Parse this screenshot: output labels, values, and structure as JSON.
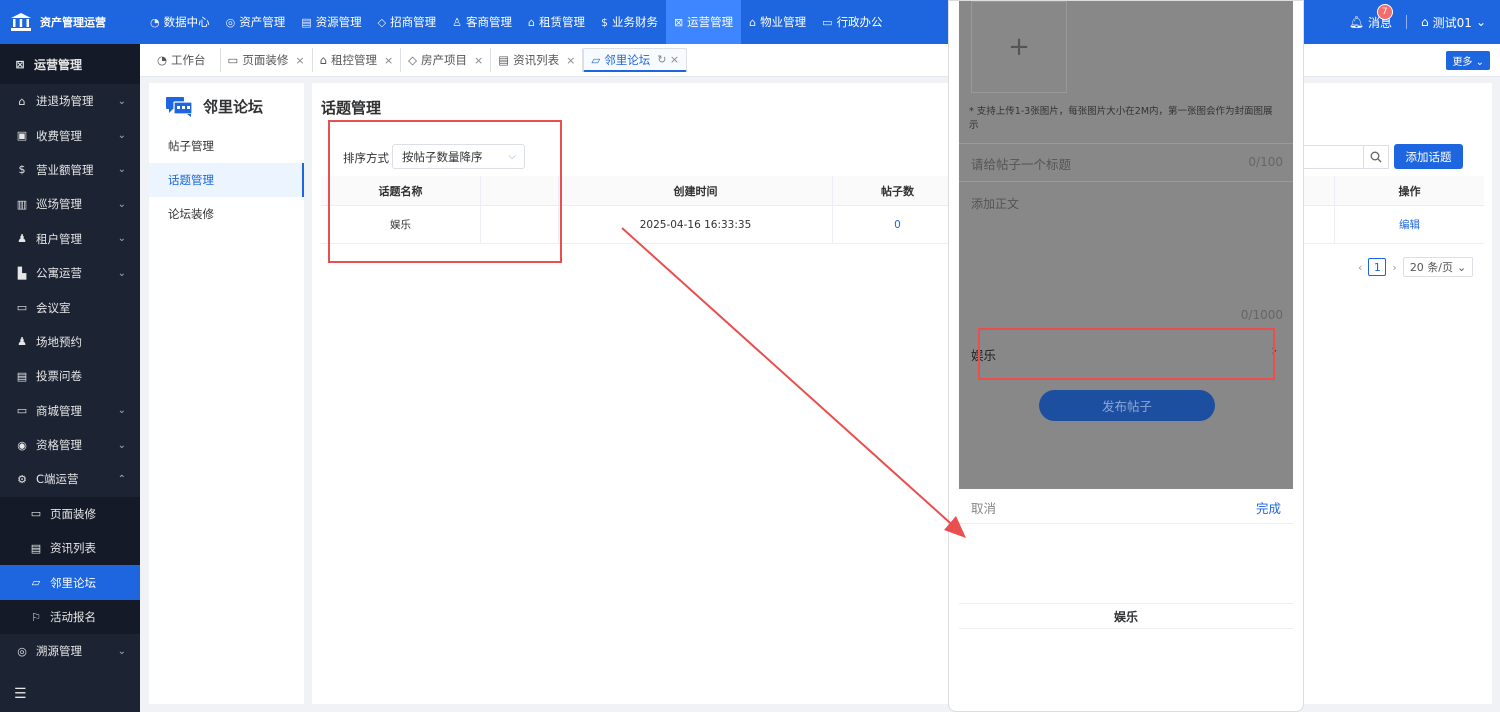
{
  "brand": {
    "name": "资产管理运营"
  },
  "topnav": [
    {
      "icon": "◔",
      "label": "数据中心"
    },
    {
      "icon": "◎",
      "label": "资产管理"
    },
    {
      "icon": "▤",
      "label": "资源管理"
    },
    {
      "icon": "◇",
      "label": "招商管理"
    },
    {
      "icon": "♙",
      "label": "客商管理"
    },
    {
      "icon": "⌂",
      "label": "租赁管理"
    },
    {
      "icon": "$",
      "label": "业务财务"
    },
    {
      "icon": "⊠",
      "label": "运营管理"
    },
    {
      "icon": "⌂",
      "label": "物业管理"
    },
    {
      "icon": "▭",
      "label": "行政办公"
    }
  ],
  "top_right": {
    "message_label": "消息",
    "message_count": "7",
    "user_label": "测试01"
  },
  "sidebar": {
    "header": "运营管理",
    "items": [
      {
        "icon": "⌂",
        "label": "进退场管理",
        "chev": "⌄"
      },
      {
        "icon": "▣",
        "label": "收费管理",
        "chev": "⌄"
      },
      {
        "icon": "$",
        "label": "营业额管理",
        "chev": "⌄"
      },
      {
        "icon": "▥",
        "label": "巡场管理",
        "chev": "⌄"
      },
      {
        "icon": "♟",
        "label": "租户管理",
        "chev": "⌄"
      },
      {
        "icon": "▙",
        "label": "公寓运营",
        "chev": "⌄"
      },
      {
        "icon": "▭",
        "label": "会议室",
        "chev": ""
      },
      {
        "icon": "♟",
        "label": "场地预约",
        "chev": ""
      },
      {
        "icon": "▤",
        "label": "投票问卷",
        "chev": ""
      },
      {
        "icon": "▭",
        "label": "商城管理",
        "chev": "⌄"
      },
      {
        "icon": "◉",
        "label": "资格管理",
        "chev": "⌄"
      },
      {
        "icon": "⚙",
        "label": "C端运营",
        "chev": "⌃"
      }
    ],
    "sub_items": [
      {
        "icon": "▭",
        "label": "页面装修"
      },
      {
        "icon": "▤",
        "label": "资讯列表"
      },
      {
        "icon": "▱",
        "label": "邻里论坛"
      },
      {
        "icon": "⚐",
        "label": "活动报名"
      }
    ],
    "last_item": {
      "icon": "◎",
      "label": "溯源管理",
      "chev": "⌄"
    },
    "footer_icon": "☰"
  },
  "tabs": [
    {
      "icon": "◔",
      "label": "工作台",
      "close": ""
    },
    {
      "icon": "▭",
      "label": "页面装修",
      "close": "×"
    },
    {
      "icon": "⌂",
      "label": "租控管理",
      "close": "×"
    },
    {
      "icon": "◇",
      "label": "房产项目",
      "close": "×"
    },
    {
      "icon": "▤",
      "label": "资讯列表",
      "close": "×"
    },
    {
      "icon": "▱",
      "label": "邻里论坛",
      "close": "↻ ×"
    }
  ],
  "more_label": "更多 ⌄",
  "left_panel": {
    "title": "邻里论坛",
    "items": [
      "帖子管理",
      "话题管理",
      "论坛装修"
    ]
  },
  "main": {
    "title": "话题管理",
    "sort_label": "排序方式",
    "sort_value": "按帖子数量降序",
    "add_label": "添加话题",
    "columns": [
      "话题名称",
      "",
      "创建时间",
      "帖子数",
      "",
      "操作"
    ],
    "rows": [
      {
        "name": "娱乐",
        "extra": "",
        "created": "2025-04-16 16:33:35",
        "posts": "0",
        "blank": "",
        "action": "编辑"
      }
    ],
    "pager": {
      "page": "1",
      "size": "20 条/页"
    }
  },
  "phone": {
    "upload_plus": "+",
    "upload_tip": "* 支持上传1-3张图片，每张图片大小在2M内，第一张图会作为封面图展示",
    "title_placeholder": "请给帖子一个标题",
    "title_count": "0/100",
    "body_placeholder": "添加正文",
    "body_count": "0/1000",
    "topic_value": "娱乐",
    "publish_label": "发布帖子",
    "picker_cancel": "取消",
    "picker_done": "完成",
    "picker_option": "娱乐"
  },
  "colors": {
    "primary": "#1d66e0",
    "annotation": "#ea4f4f",
    "sidebar_bg": "#1c2333"
  }
}
